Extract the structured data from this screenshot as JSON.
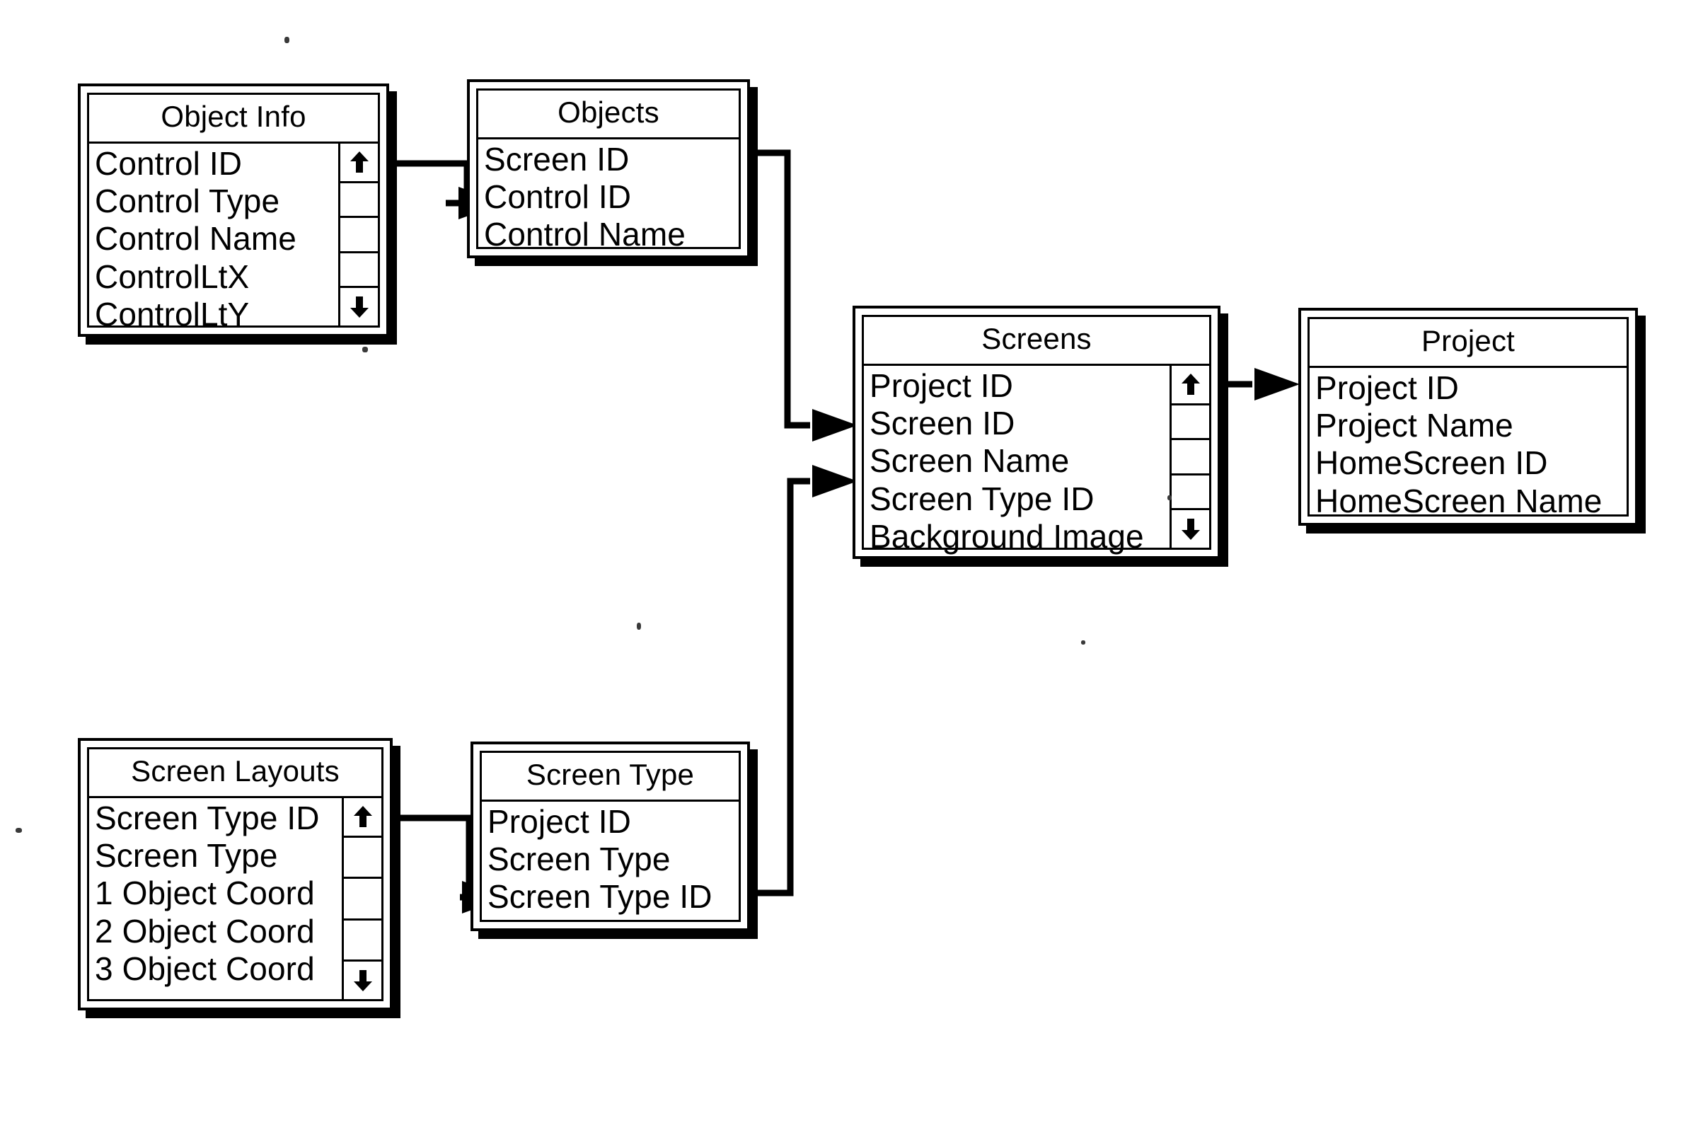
{
  "diagram": {
    "title": "Database Schema Diagram",
    "background_color": "#ffffff",
    "line_color": "#000000"
  },
  "entities": [
    {
      "id": "object-info",
      "title": "Object Info",
      "fields": [
        "Control ID",
        "Control Type",
        "Control Name",
        "ControlLtX",
        "ControlLtY"
      ],
      "has_scrollbar": true,
      "scrollbar": {
        "up_icon": "scroll-up-arrow-icon",
        "down_icon": "scroll-down-arrow-icon",
        "up_glyph": "↑",
        "down_glyph": "↓",
        "segments": 3
      }
    },
    {
      "id": "objects",
      "title": "Objects",
      "fields": [
        "Screen ID",
        "Control ID",
        "Control Name"
      ],
      "has_scrollbar": false
    },
    {
      "id": "screens",
      "title": "Screens",
      "fields": [
        "Project ID",
        "Screen ID",
        "Screen Name",
        "Screen Type ID",
        "Background Image"
      ],
      "has_scrollbar": true,
      "scrollbar": {
        "up_icon": "scroll-up-arrow-icon",
        "down_icon": "scroll-down-arrow-icon",
        "up_glyph": "↑",
        "down_glyph": "↓",
        "segments": 3
      }
    },
    {
      "id": "project",
      "title": "Project",
      "fields": [
        "Project ID",
        "Project Name",
        "HomeScreen ID",
        "HomeScreen Name"
      ],
      "has_scrollbar": false
    },
    {
      "id": "screen-layouts",
      "title": "Screen Layouts",
      "fields": [
        "Screen Type ID",
        "Screen Type",
        "1 Object Coord",
        "2 Object Coord",
        "3 Object Coord"
      ],
      "has_scrollbar": true,
      "scrollbar": {
        "up_icon": "scroll-up-arrow-icon",
        "down_icon": "scroll-down-arrow-icon",
        "up_glyph": "↑",
        "down_glyph": "↓",
        "segments": 3
      }
    },
    {
      "id": "screen-type",
      "title": "Screen Type",
      "fields": [
        "Project ID",
        "Screen Type",
        "Screen Type ID"
      ],
      "has_scrollbar": false
    }
  ],
  "relationships": [
    {
      "id": "object-info-to-objects",
      "from": "Object Info",
      "to": "Objects",
      "from_field": "Control ID",
      "to_field": "Control ID"
    },
    {
      "id": "objects-to-screens",
      "from": "Objects",
      "to": "Screens",
      "from_field": "Screen ID",
      "to_field": "Screen Name"
    },
    {
      "id": "screens-to-project",
      "from": "Screens",
      "to": "Project",
      "from_field": "Project ID",
      "to_field": "Project ID"
    },
    {
      "id": "screen-layouts-to-screen-type",
      "from": "Screen Layouts",
      "to": "Screen Type",
      "from_field": "Screen Type ID",
      "to_field": "Screen Type"
    },
    {
      "id": "screen-type-to-screens",
      "from": "Screen Type",
      "to": "Screens",
      "from_field": "Screen Type ID",
      "to_field": "Screen Type ID"
    }
  ]
}
